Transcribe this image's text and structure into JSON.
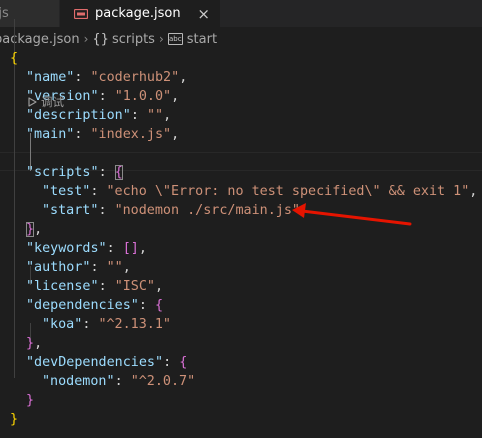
{
  "tabs": {
    "inactive_label": "n.js",
    "active_label": "package.json",
    "close_glyph": "×"
  },
  "breadcrumb": {
    "items": [
      "package.json",
      "scripts",
      "start"
    ],
    "separator": "›",
    "braces_glyph": "{}",
    "string_icon_text": "abc"
  },
  "codelens": {
    "label": "调试"
  },
  "code": {
    "open_brace": "{",
    "close_brace": "}",
    "name_key": "\"name\"",
    "name_val": "\"coderhub2\"",
    "version_key": "\"version\"",
    "version_val": "\"1.0.0\"",
    "description_key": "\"description\"",
    "description_val": "\"\"",
    "main_key": "\"main\"",
    "main_val": "\"index.js\"",
    "scripts_key": "\"scripts\"",
    "test_key": "\"test\"",
    "test_val": "\"echo \\\"Error: no test specified\\\" && exit 1\"",
    "start_key": "\"start\"",
    "start_val": "\"nodemon ./src/main.js\"",
    "keywords_key": "\"keywords\"",
    "keywords_val": "[]",
    "author_key": "\"author\"",
    "author_val": "\"\"",
    "license_key": "\"license\"",
    "license_val": "\"ISC\"",
    "dependencies_key": "\"dependencies\"",
    "koa_key": "\"koa\"",
    "koa_val": "\"^2.13.1\"",
    "devdeps_key": "\"devDependencies\"",
    "nodemon_key": "\"nodemon\"",
    "nodemon_val": "\"^2.0.7\"",
    "colon": ": ",
    "comma": ",",
    "obj_open": "{",
    "obj_close": "}"
  },
  "colors": {
    "background": "#1e1e1e",
    "key": "#9cdcfe",
    "string": "#ce9178",
    "bracket_level0": "#ffd700",
    "bracket_level1": "#da70d6",
    "bracket_level2": "#179fff",
    "arrow": "#e51400",
    "json_icon": "#e06c6c"
  },
  "icons": {
    "tab_file": "json-file-icon",
    "close": "close-icon",
    "codelens": "play-icon",
    "annotation": "red-arrow-annotation"
  }
}
